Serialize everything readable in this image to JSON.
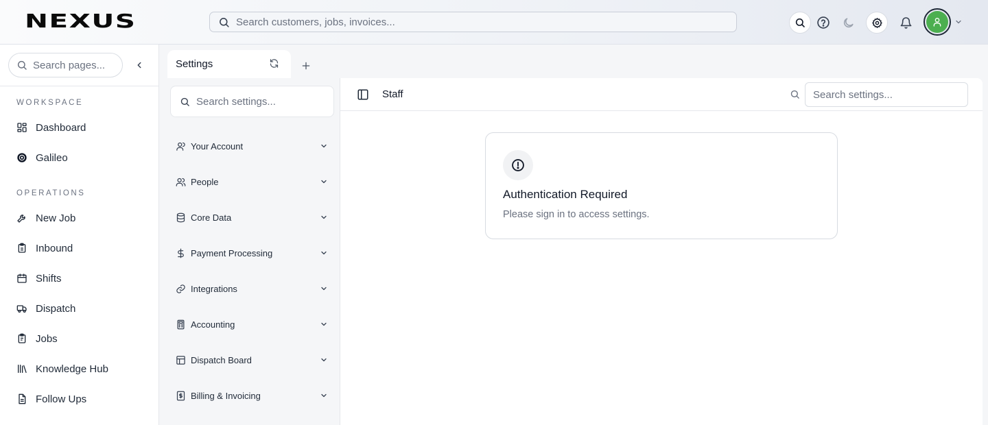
{
  "topbar": {
    "logo_text": "NEXUS",
    "search_placeholder": "Search customers, jobs, invoices...",
    "icons": [
      "search-icon",
      "help-icon",
      "moon-icon",
      "gear-icon",
      "bell-icon",
      "user-icon",
      "chevron-down-icon"
    ],
    "avatar_color": "#4caf50"
  },
  "sidebar": {
    "search_placeholder": "Search pages...",
    "sections": [
      {
        "label": "WORKSPACE",
        "items": [
          {
            "label": "Dashboard",
            "icon": "dashboard-icon"
          },
          {
            "label": "Galileo",
            "icon": "galileo-icon"
          }
        ]
      },
      {
        "label": "OPERATIONS",
        "items": [
          {
            "label": "New Job",
            "icon": "tools-icon"
          },
          {
            "label": "Inbound",
            "icon": "clipboard-icon"
          },
          {
            "label": "Shifts",
            "icon": "calendar-icon"
          },
          {
            "label": "Dispatch",
            "icon": "truck-icon"
          },
          {
            "label": "Jobs",
            "icon": "clipboard-list-icon"
          },
          {
            "label": "Knowledge Hub",
            "icon": "library-icon"
          },
          {
            "label": "Follow Ups",
            "icon": "document-icon"
          }
        ]
      }
    ]
  },
  "tabs": [
    {
      "label": "Settings",
      "active": true
    }
  ],
  "settings_nav": {
    "search_placeholder": "Search settings...",
    "items": [
      {
        "label": "Your Account",
        "icon": "user-icon"
      },
      {
        "label": "People",
        "icon": "users-icon"
      },
      {
        "label": "Core Data",
        "icon": "database-icon"
      },
      {
        "label": "Payment Processing",
        "icon": "dollar-icon"
      },
      {
        "label": "Integrations",
        "icon": "link-icon"
      },
      {
        "label": "Accounting",
        "icon": "calculator-icon"
      },
      {
        "label": "Dispatch Board",
        "icon": "board-icon"
      },
      {
        "label": "Billing & Invoicing",
        "icon": "receipt-icon"
      }
    ]
  },
  "main": {
    "title": "Staff",
    "search_placeholder": "Search settings...",
    "auth_card": {
      "title": "Authentication Required",
      "message": "Please sign in to access settings.",
      "icon": "alert-circle-icon"
    }
  }
}
